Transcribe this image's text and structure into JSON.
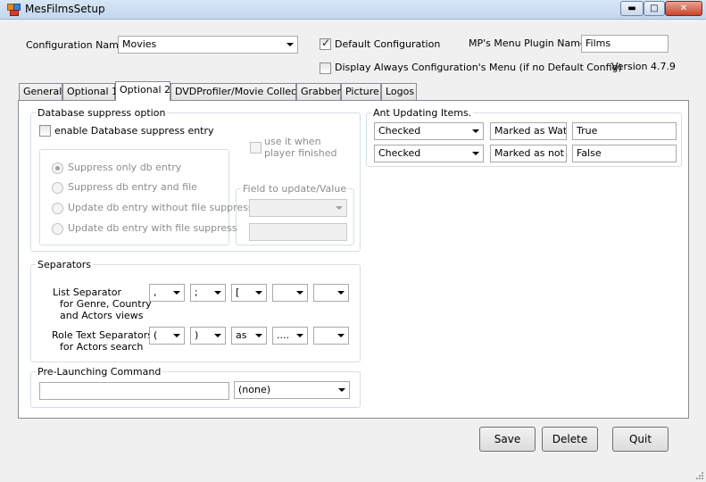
{
  "window": {
    "title": "MesFilmsSetup",
    "min_icon": "minimize-icon",
    "max_icon": "maximize-icon",
    "close_icon": "close-icon"
  },
  "config": {
    "name_label": "Configuration Name",
    "name_value": "Movies",
    "default_label": "Default Configuration",
    "default_checked": true,
    "plugin_name_label": "MP's Menu Plugin Name",
    "plugin_name_value": "Films",
    "display_always_label": "Display Always Configuration's Menu (if no Default Config)",
    "display_always_checked": false,
    "version": "Version 4.7.9"
  },
  "tabs": [
    {
      "label": "General"
    },
    {
      "label": "Optional 1"
    },
    {
      "label": "Optional 2",
      "active": true
    },
    {
      "label": "DVDProfiler/Movie Collecor"
    },
    {
      "label": "Grabber"
    },
    {
      "label": "Picture"
    },
    {
      "label": "Logos"
    }
  ],
  "db_suppress": {
    "title": "Database suppress option",
    "enable_label": "enable Database suppress entry",
    "enable_checked": false,
    "use_when_label_1": "use it when",
    "use_when_label_2": "player finished",
    "options": [
      {
        "label": "Suppress only db entry",
        "selected": true
      },
      {
        "label": "Suppress db entry and file",
        "selected": false
      },
      {
        "label": "Update db entry without file suppress",
        "selected": false
      },
      {
        "label": "Update db entry with file suppress",
        "selected": false
      }
    ],
    "field_update_title": "Field to update/Value"
  },
  "separators": {
    "title": "Separators",
    "list_label_1": "List Separator",
    "list_label_2": "for Genre, Country",
    "list_label_3": "and Actors views",
    "list_values": [
      ",",
      ";",
      "[",
      "",
      ""
    ],
    "role_label_1": "Role Text Separators",
    "role_label_2": "for Actors search",
    "role_values": [
      "(",
      ")",
      "as",
      "....",
      ""
    ]
  },
  "prelaunch": {
    "title": "Pre-Launching Command",
    "command_value": "",
    "option_value": "(none)"
  },
  "ant_updating": {
    "title": "Ant Updating Items.",
    "rows": [
      {
        "state": "Checked",
        "field": "Marked as Watch",
        "value": "True"
      },
      {
        "state": "Checked",
        "field": "Marked as not W",
        "value": "False"
      }
    ]
  },
  "buttons": {
    "save": "Save",
    "delete": "Delete",
    "quit": "Quit"
  }
}
